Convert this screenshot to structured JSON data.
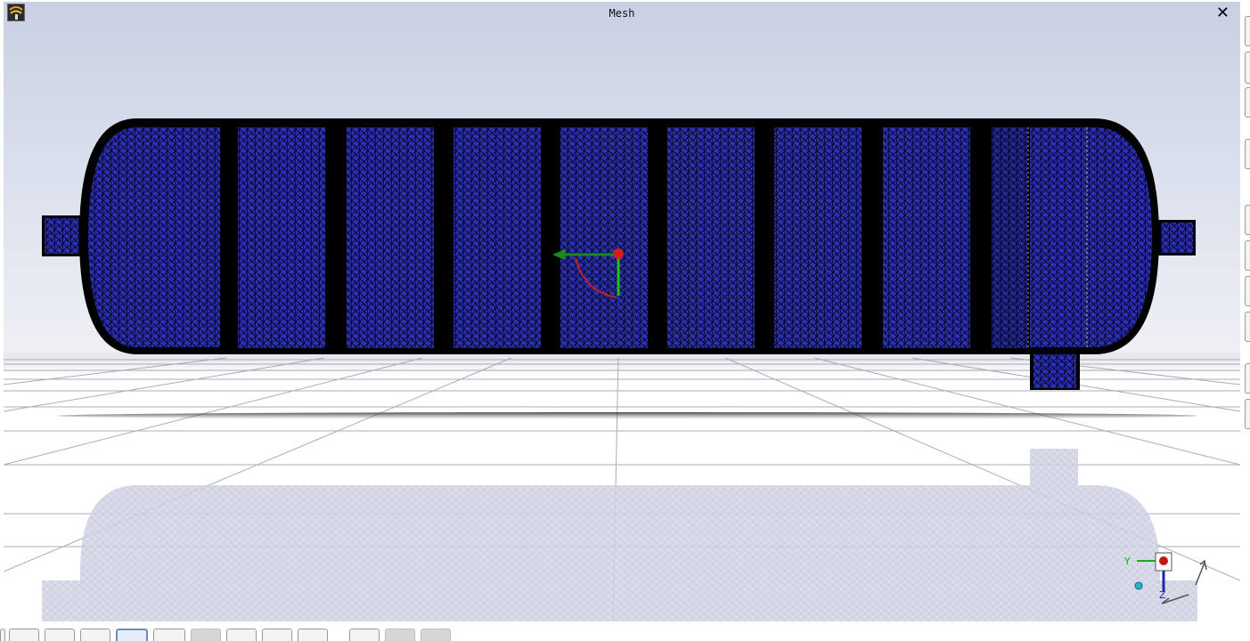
{
  "window": {
    "title": "Mesh",
    "close_glyph": "✕"
  },
  "app_icon": {
    "icon": "application-logo-icon"
  },
  "scene": {
    "model": "tank-mesh",
    "mesh_color": "#2a2fb0",
    "edge_color": "#000000",
    "grid_color": "#9ea4ad",
    "background_top": "#c9d0e2",
    "floor_color": "#ffffff"
  },
  "triad": {
    "y_label": "Y",
    "z_label": "Z"
  },
  "right_toolbar": {
    "buttons": [
      {
        "icon": "toolbar-button-icon"
      },
      {
        "icon": "toolbar-button-icon"
      },
      {
        "icon": "toolbar-button-icon"
      },
      {
        "icon": "toolbar-button-icon"
      },
      {
        "icon": "toolbar-button-icon"
      },
      {
        "icon": "toolbar-button-icon"
      },
      {
        "icon": "toolbar-button-icon"
      },
      {
        "icon": "toolbar-button-icon"
      },
      {
        "icon": "toolbar-button-icon"
      },
      {
        "icon": "toolbar-button-icon"
      }
    ]
  },
  "bottom_toolbar": {
    "buttons": [
      {
        "icon": "view-button-icon"
      },
      {
        "icon": "view-button-icon"
      },
      {
        "icon": "view-button-icon"
      },
      {
        "icon": "view-button-icon"
      },
      {
        "icon": "select-arrow-icon",
        "selected": true
      },
      {
        "icon": "view-button-icon"
      },
      {
        "icon": "view-button-icon"
      },
      {
        "icon": "view-button-icon"
      },
      {
        "icon": "view-button-icon"
      },
      {
        "icon": "view-button-icon"
      },
      {
        "icon": "view-button-icon"
      },
      {
        "icon": "view-button-icon"
      },
      {
        "icon": "view-button-icon"
      }
    ]
  }
}
